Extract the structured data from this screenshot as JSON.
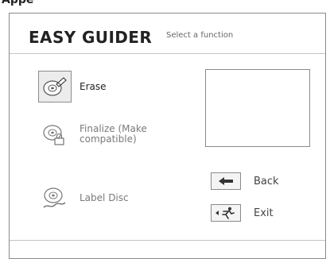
{
  "top_label": "Appe",
  "header": {
    "brand": "EASY GUIDER",
    "subtitle": "Select a function"
  },
  "functions": [
    {
      "label": "Erase",
      "icon": "disc-eraser-icon",
      "state": "selected"
    },
    {
      "label": "Finalize (Make compatible)",
      "icon": "disc-lock-icon",
      "state": "normal"
    },
    {
      "label": "Label Disc",
      "icon": "disc-label-icon",
      "state": "normal"
    }
  ],
  "actions": {
    "back_label": "Back",
    "exit_label": "Exit"
  },
  "colors": {
    "border": "#8a8a8a",
    "divider": "#c4c4c4",
    "selected_bg": "#ececec"
  }
}
